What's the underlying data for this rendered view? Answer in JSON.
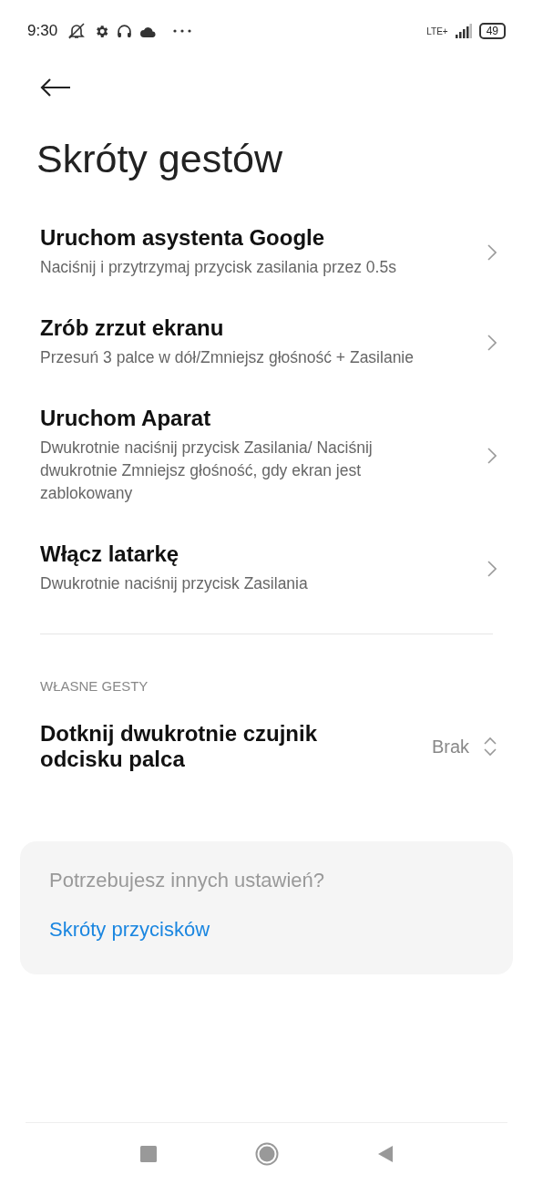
{
  "status_bar": {
    "time": "9:30",
    "network": "LTE+",
    "battery": "49"
  },
  "title": "Skróty gestów",
  "shortcuts": [
    {
      "title": "Uruchom asystenta Google",
      "description": "Naciśnij i przytrzymaj przycisk zasilania przez 0.5s"
    },
    {
      "title": "Zrób zrzut ekranu",
      "description": "Przesuń 3 palce w dół/Zmniejsz głośność + Zasilanie"
    },
    {
      "title": "Uruchom Aparat",
      "description": "Dwukrotnie naciśnij przycisk Zasilania/ Naciśnij dwukrotnie Zmniejsz głośność, gdy ekran jest zablokowany"
    },
    {
      "title": "Włącz latarkę",
      "description": "Dwukrotnie naciśnij przycisk Zasilania"
    }
  ],
  "section_header": "WŁASNE GESTY",
  "custom_gestures": [
    {
      "title": "Dotknij dwukrotnie czujnik odcisku palca",
      "value": "Brak"
    }
  ],
  "help_card": {
    "question": "Potrzebujesz innych ustawień?",
    "link": "Skróty przycisków"
  }
}
